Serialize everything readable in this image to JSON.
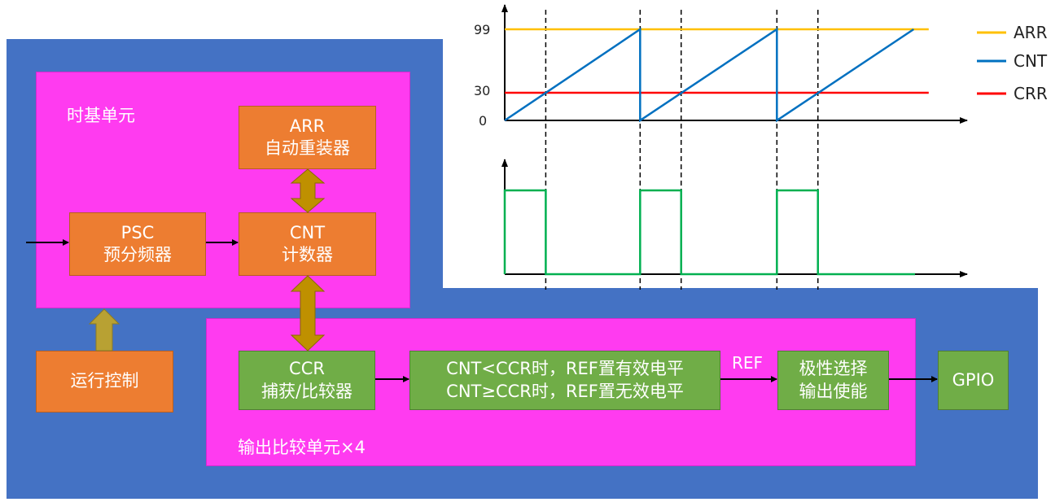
{
  "diagram": {
    "timebase_unit_label": "时基单元",
    "arr_box": {
      "line1": "ARR",
      "line2": "自动重装器"
    },
    "psc_box": {
      "line1": "PSC",
      "line2": "预分频器"
    },
    "cnt_box": {
      "line1": "CNT",
      "line2": "计数器"
    },
    "run_control": "运行控制",
    "ccr_box": {
      "line1": "CCR",
      "line2": "捕获/比较器"
    },
    "compare_box": {
      "line1": "CNT<CCR时，REF置有效电平",
      "line2": "CNT≥CCR时，REF置无效电平"
    },
    "ref_label": "REF",
    "polarity_box": {
      "line1": "极性选择",
      "line2": "输出使能"
    },
    "gpio_box": "GPIO",
    "output_compare_unit_label": "输出比较单元×4",
    "colors": {
      "background_blue": "#4472C4",
      "unit_magenta": "#FF3BF0",
      "orange": "#ED7D31",
      "green": "#70AD47",
      "double_arrow": "#BF9000",
      "up_arrow": "#B8A133"
    }
  },
  "chart_data": [
    {
      "type": "line",
      "y_ticks": [
        "99",
        "30",
        "0"
      ],
      "ylim": [
        0,
        99
      ],
      "period": 100,
      "x_range": [
        0,
        300
      ],
      "series": [
        {
          "name": "ARR",
          "color": "#FFC000",
          "x": [
            0,
            310
          ],
          "y": [
            99,
            99
          ]
        },
        {
          "name": "CNT",
          "color": "#0070C0",
          "x": [
            0,
            99,
            99,
            199,
            199,
            299
          ],
          "y": [
            0,
            99,
            0,
            99,
            0,
            99
          ]
        },
        {
          "name": "CRR",
          "color": "#FF0000",
          "x": [
            0,
            310
          ],
          "y": [
            30,
            30
          ]
        }
      ],
      "markers_x": [
        30,
        99,
        129,
        199,
        229
      ]
    },
    {
      "type": "line",
      "series": [
        {
          "color": "#00B050",
          "x": [
            0,
            0,
            30,
            30,
            99,
            99,
            129,
            129,
            199,
            199,
            229,
            229,
            300
          ],
          "y": [
            0,
            1,
            1,
            0,
            0,
            1,
            1,
            0,
            0,
            1,
            1,
            0,
            0
          ]
        }
      ],
      "ylim": [
        0,
        1
      ]
    }
  ]
}
